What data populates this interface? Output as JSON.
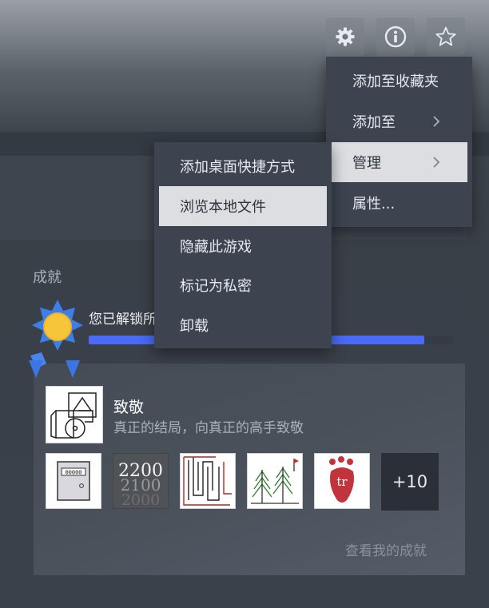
{
  "toolbar": {
    "icons": [
      "gear-icon",
      "info-icon",
      "star-icon"
    ]
  },
  "main_menu": {
    "items": [
      {
        "label": "添加至收藏夹",
        "submenu": false
      },
      {
        "label": "添加至",
        "submenu": true
      },
      {
        "label": "管理",
        "submenu": true,
        "highlighted": true
      },
      {
        "label": "属性..."
      }
    ]
  },
  "sub_menu": {
    "items": [
      {
        "label": "添加桌面快捷方式"
      },
      {
        "label": "浏览本地文件",
        "highlighted": true
      },
      {
        "label": "隐藏此游戏"
      },
      {
        "label": "标记为私密"
      },
      {
        "label": "卸载"
      }
    ]
  },
  "achievements": {
    "heading": "成就",
    "unlocked_text": "您已解锁所",
    "progress_fraction": 0.92,
    "featured": {
      "title": "致敬",
      "description": "真正的结局，向真正的高手致敬"
    },
    "more_count": "+10",
    "view_link": "查看我的成就",
    "thumb_texts": {
      "meter": "00000",
      "n1": "2200",
      "n2": "2100",
      "n3": "2000",
      "tr": "tr"
    }
  },
  "colors": {
    "progress": "#4b6af5",
    "menu_bg": "#3d4450",
    "highlight": "#dcdee2"
  }
}
